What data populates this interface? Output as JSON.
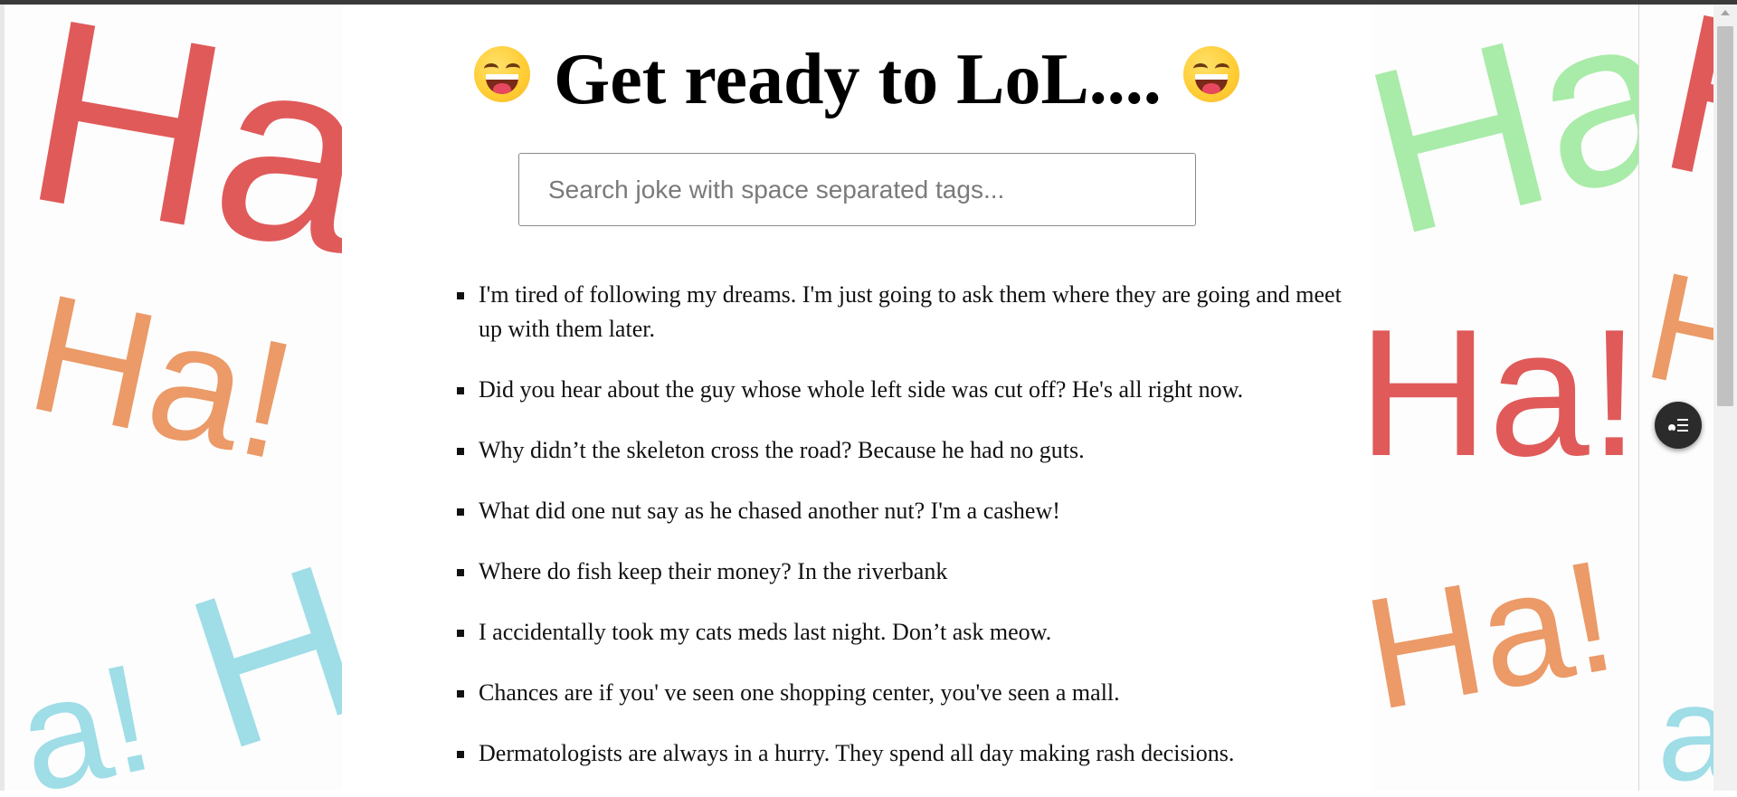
{
  "title": "Get ready to LoL....",
  "search": {
    "placeholder": "Search joke with space separated tags...",
    "value": ""
  },
  "jokes": [
    "I'm tired of following my dreams. I'm just going to ask them where they are going and meet up with them later.",
    "Did you hear about the guy whose whole left side was cut off? He's all right now.",
    "Why didn’t the skeleton cross the road? Because he had no guts.",
    "What did one nut say as he chased another nut? I'm a cashew!",
    "Where do fish keep their money? In the riverbank",
    "I accidentally took my cats meds last night. Don’t ask meow.",
    "Chances are if you' ve seen one shopping center, you've seen a mall.",
    "Dermatologists are always in a hurry. They spend all day making rash decisions."
  ],
  "background": {
    "left": [
      {
        "text": "Ha",
        "color": "red"
      },
      {
        "text": "Ha!",
        "color": "orange"
      },
      {
        "text": "Ha",
        "color": "blue"
      },
      {
        "text": "a!",
        "color": "blue"
      }
    ],
    "right": [
      {
        "text": "Ha",
        "color": "green"
      },
      {
        "text": "Ha!",
        "color": "red"
      },
      {
        "text": "Ha!",
        "color": "orange"
      }
    ],
    "far": [
      {
        "text": "Ha",
        "color": "red"
      },
      {
        "text": "Ha",
        "color": "orange"
      },
      {
        "text": "a",
        "color": "blue"
      }
    ]
  },
  "colors": {
    "red": "#e05a5a",
    "orange": "#eb9a68",
    "blue": "#9fdde7",
    "green": "#a9eba9"
  },
  "icons": {
    "emoji": "grinning-face-with-tongue-icon",
    "fab": "text-to-speech-icon"
  }
}
